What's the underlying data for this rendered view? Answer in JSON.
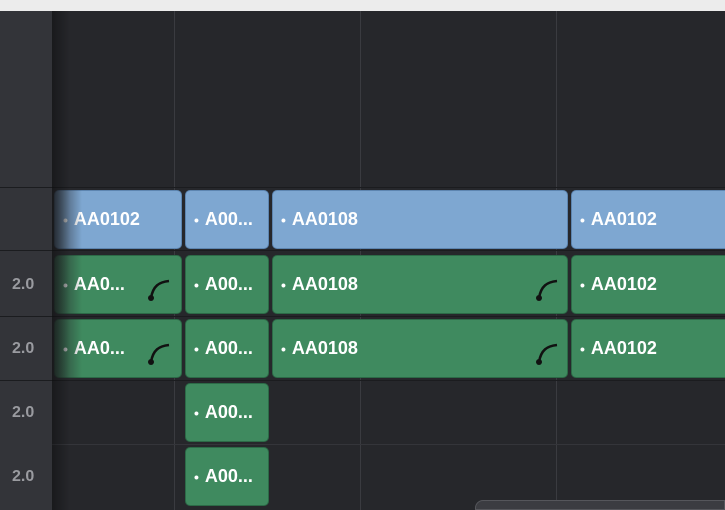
{
  "tracks": [
    {
      "label": ""
    },
    {
      "label": "2.0"
    },
    {
      "label": "2.0"
    },
    {
      "label": "2.0"
    },
    {
      "label": "2.0"
    }
  ],
  "clips": {
    "video": [
      {
        "name": "AA0102"
      },
      {
        "name": "A00..."
      },
      {
        "name": "AA0108"
      },
      {
        "name": "AA0102"
      }
    ],
    "audio1": [
      {
        "name": "AA0...",
        "icon": "fade-curve-icon"
      },
      {
        "name": "A00..."
      },
      {
        "name": "AA0108",
        "icon": "fade-curve-icon"
      },
      {
        "name": "AA0102"
      }
    ],
    "audio2": [
      {
        "name": "AA0...",
        "icon": "fade-curve-icon"
      },
      {
        "name": "A00..."
      },
      {
        "name": "AA0108",
        "icon": "fade-curve-icon"
      },
      {
        "name": "AA0102"
      }
    ],
    "audio3": [
      {
        "name": "A00..."
      }
    ],
    "audio4": [
      {
        "name": "A00..."
      }
    ]
  },
  "colors": {
    "video_clip": "#7ea7d1",
    "audio_clip": "#3f8a5f",
    "background": "#26272b"
  }
}
